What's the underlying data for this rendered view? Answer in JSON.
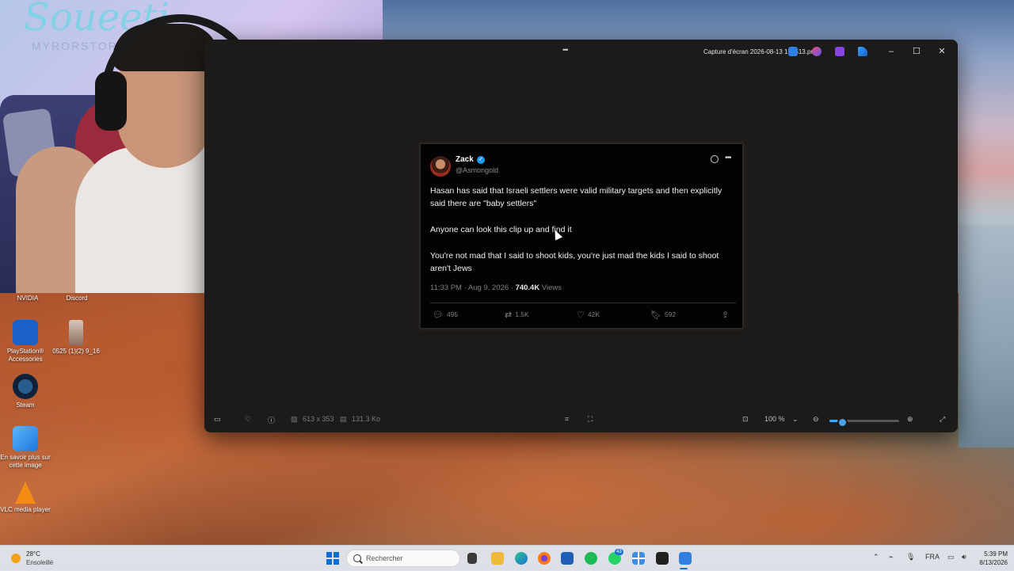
{
  "viewer": {
    "title": "Capture d'écran 2026-08-13 161513.png",
    "dimensions": "613 x 353",
    "file_size": "131.3 Ko",
    "zoom": "100 %",
    "zoom_level_fraction": 0.18,
    "window_controls": {
      "minimize": "–",
      "maximize": "☐",
      "close": "✕"
    }
  },
  "tweet": {
    "name": "Zack",
    "handle": "@Asmongold",
    "paragraph_1": "Hasan has said that Israeli settlers were valid military targets and then explicitly said there are \"baby settlers\"",
    "paragraph_2": "Anyone can look this clip up and find it",
    "paragraph_3": "You're not mad that I said to shoot kids, you're just mad the kids I said to shoot aren't Jews",
    "time": "11:33 PM · Aug 9, 2026 · ",
    "views_count": "740.4K",
    "views_label": " Views",
    "replies": "495",
    "reposts": "1.5K",
    "likes": "42K",
    "bookmarks": "592"
  },
  "desktop_icons": [
    {
      "label": "NVIDIA"
    },
    {
      "label": "Discord"
    },
    {
      "label": "PlayStation® Accessories"
    },
    {
      "label": "0525 (1)(2) 9_16"
    },
    {
      "label": "Steam"
    },
    {
      "label": "En savoir plus sur cette image"
    },
    {
      "label": "VLC media player"
    }
  ],
  "taskbar": {
    "weather_temp": "28°C",
    "weather_condition": "Ensoleillé",
    "search_placeholder": "Rechercher",
    "whatsapp_badge": "43",
    "language": "FRA",
    "time": "5:39 PM",
    "date": "8/13/2026"
  },
  "colors": {
    "accent": "#1d9bf0",
    "zoom_accent": "#4aa3e6",
    "taskbar_accent": "#0a6cd6"
  }
}
